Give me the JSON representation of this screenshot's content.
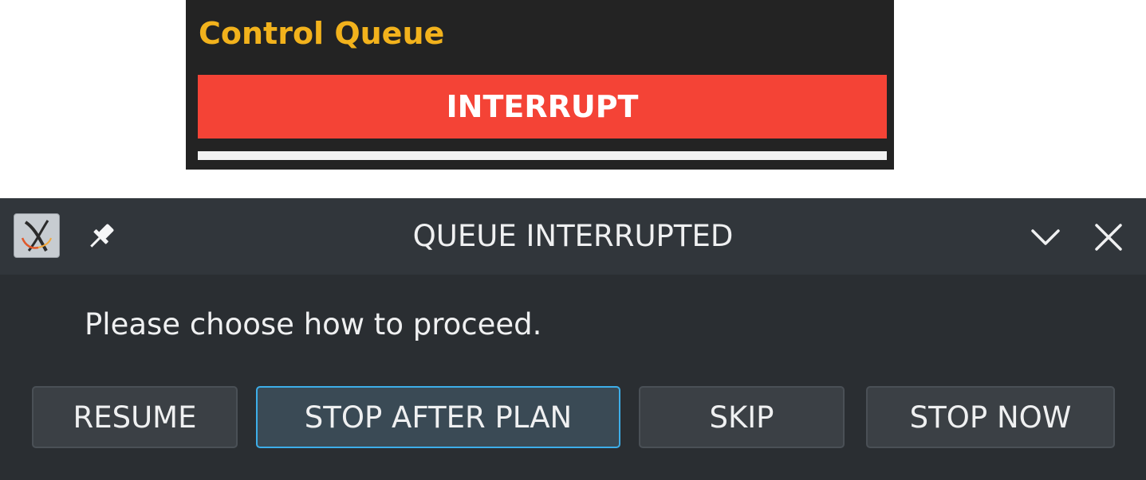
{
  "control_queue": {
    "title": "Control Queue",
    "interrupt_label": "INTERRUPT",
    "title_color": "#f2b21c",
    "interrupt_color": "#f44336"
  },
  "dialog": {
    "window_title": "QUEUE INTERRUPTED",
    "message": "Please choose how to proceed.",
    "icons": [
      "app-icon",
      "pin-icon",
      "chevron-down-icon",
      "close-icon"
    ],
    "buttons": {
      "resume": "RESUME",
      "stop_after_plan": "STOP AFTER PLAN",
      "skip": "SKIP",
      "stop_now": "STOP NOW"
    },
    "focused_button": "STOP AFTER PLAN",
    "accent_color": "#3daee9"
  }
}
